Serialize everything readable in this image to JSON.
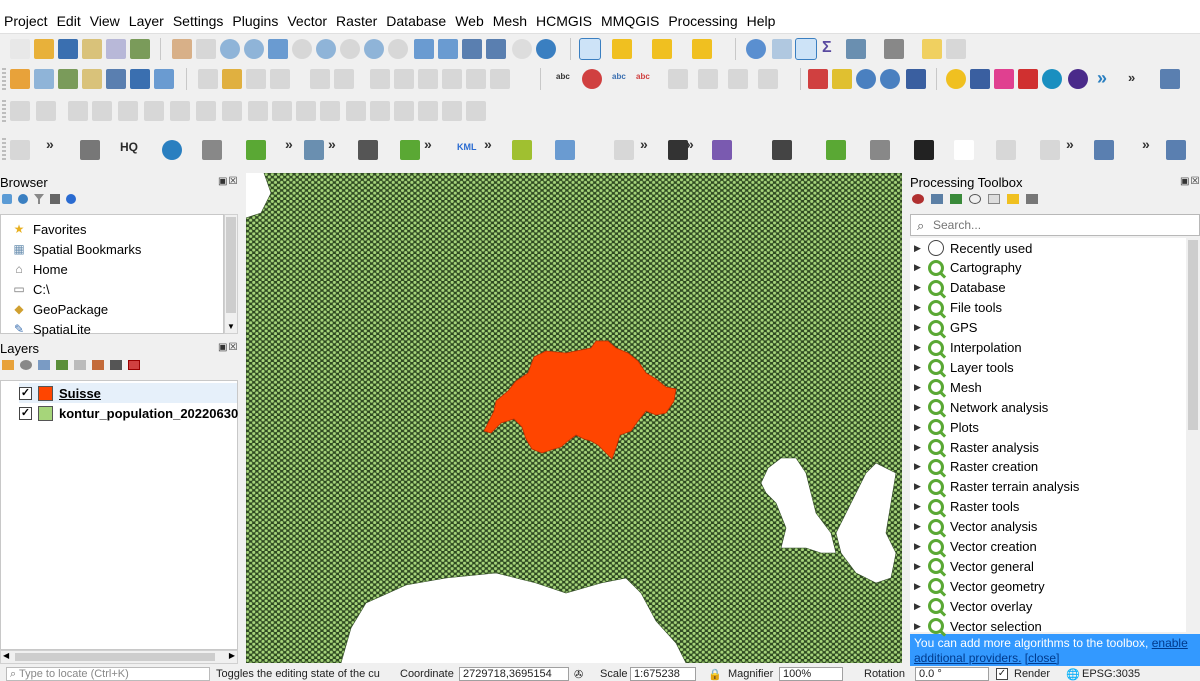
{
  "menu": [
    "Project",
    "Edit",
    "View",
    "Layer",
    "Settings",
    "Plugins",
    "Vector",
    "Raster",
    "Database",
    "Web",
    "Mesh",
    "HCMGIS",
    "MMQGIS",
    "Processing",
    "Help"
  ],
  "browser": {
    "title": "Browser",
    "items": [
      {
        "label": "Favorites",
        "icon": "star-icon"
      },
      {
        "label": "Spatial Bookmarks",
        "icon": "bookmark-icon"
      },
      {
        "label": "Home",
        "icon": "home-folder-icon"
      },
      {
        "label": "C:\\",
        "icon": "folder-icon"
      },
      {
        "label": "GeoPackage",
        "icon": "geopackage-icon"
      },
      {
        "label": "SpatiaLite",
        "icon": "spatialite-icon"
      }
    ]
  },
  "layers": {
    "title": "Layers",
    "items": [
      {
        "label": "Suisse",
        "color": "#ff4500",
        "checked": true
      },
      {
        "label": "kontur_population_20220630",
        "color": "#a6d57a",
        "checked": true
      }
    ]
  },
  "toolbox": {
    "title": "Processing Toolbox",
    "search_placeholder": "Search...",
    "recently_used": "Recently used",
    "groups": [
      "Cartography",
      "Database",
      "File tools",
      "GPS",
      "Interpolation",
      "Layer tools",
      "Mesh",
      "Network analysis",
      "Plots",
      "Raster analysis",
      "Raster creation",
      "Raster terrain analysis",
      "Raster tools",
      "Vector analysis",
      "Vector creation",
      "Vector general",
      "Vector geometry",
      "Vector overlay",
      "Vector selection"
    ],
    "info_text": "You can add more algorithms to the toolbox,",
    "info_link": "enable additional providers.",
    "info_close": "[close]"
  },
  "status": {
    "locate_placeholder": "Type to locate (Ctrl+K)",
    "message": "Toggles the editing state of the cu",
    "coordinate_label": "Coordinate",
    "coordinate_value": "2729718,3695154",
    "scale_label": "Scale",
    "scale_value": "1:675238",
    "magnifier_label": "Magnifier",
    "magnifier_value": "100%",
    "rotation_label": "Rotation",
    "rotation_value": "0.0 °",
    "render_label": "Render",
    "crs": "EPSG:3035"
  },
  "colors": {
    "hex_fill": "#a6d57a",
    "hex_stroke": "#2f4a22",
    "suisse": "#ff4500",
    "accent": "#3399ff"
  },
  "toolbar_strings": {
    "kml": "KML",
    "hq": "HQ",
    "sigma": "Σ",
    "abc": "abc",
    "more": "»"
  }
}
